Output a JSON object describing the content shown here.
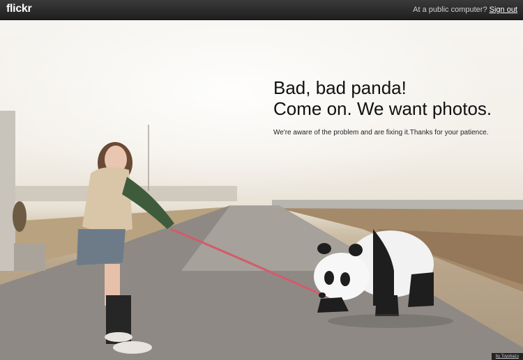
{
  "header": {
    "logo": "flickr",
    "prompt": "At a public computer?",
    "signout_label": "Sign out"
  },
  "message": {
    "title_line1": "Bad, bad panda!",
    "title_line2": "Come on. We want photos.",
    "body": "We're aware of the problem and are fixing it.Thanks for your patience."
  },
  "photo": {
    "credit": "by Toyokazu"
  },
  "colors": {
    "topbar": "#2b2b2b",
    "text_dark": "#111111",
    "leash": "#d45a6a"
  }
}
